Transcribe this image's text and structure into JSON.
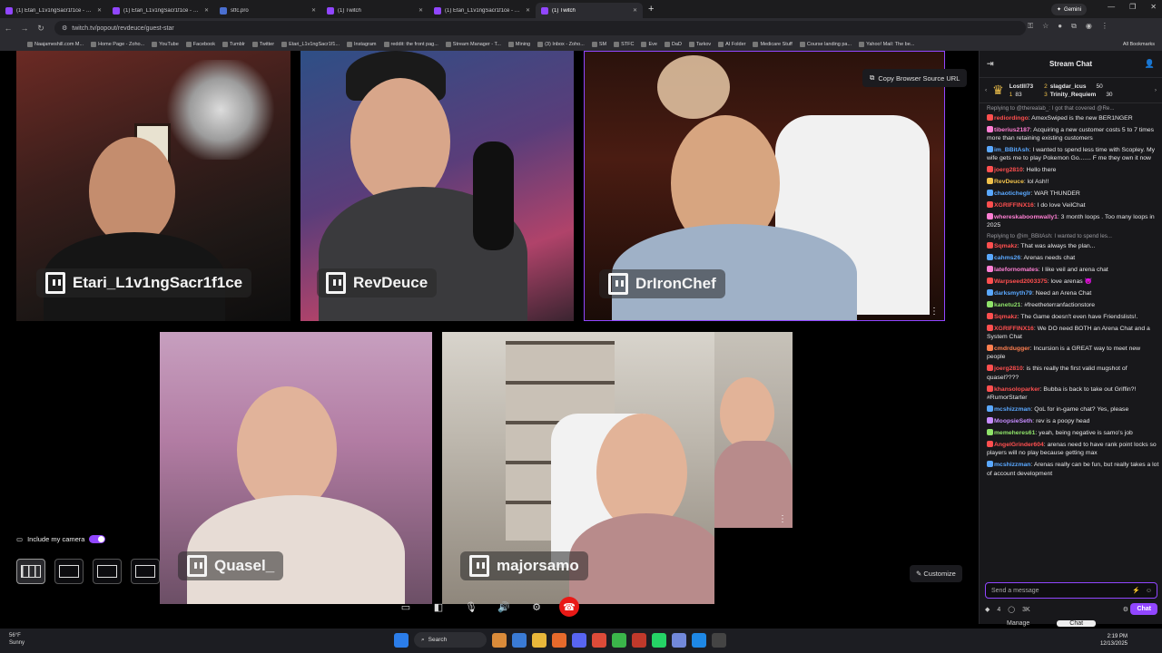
{
  "tabs": [
    {
      "title": "(1) Etari_L1v1ngSacr1f1ce - Vid",
      "active": false
    },
    {
      "title": "(1) Etari_L1v1ngSacr1f1ce - Vid",
      "active": false
    },
    {
      "title": "stfc.pro",
      "active": false
    },
    {
      "title": "(1) Twitch",
      "active": false
    },
    {
      "title": "(1) Etari_L1v1ngSacr1f1ce - Twi",
      "active": false
    },
    {
      "title": "(1) Twitch",
      "active": true
    }
  ],
  "gemini": "Gemini",
  "url": "twitch.tv/popout/revdeuce/guest-star",
  "bookmarks": [
    "Naajameshill.com M...",
    "Home Page - Zoho...",
    "YouTube",
    "Facebook",
    "Tumblr",
    "Twitter",
    "Etari_L1v1ngSacr1f1...",
    "Instagram",
    "reddit: the front pag...",
    "Stream Manager - T...",
    "Mining",
    "(3) Inbox - Zoho...",
    "SM",
    "STFC",
    "Eve",
    "DaD",
    "Tarkov",
    "AI Folder",
    "Medicare Stuff",
    "Course landing pa...",
    "Yahoo! Mail: The be..."
  ],
  "all_bookmarks": "All Bookmarks",
  "stage": {
    "copy_url": "Copy Browser Source URL",
    "include_camera": "Include my camera",
    "customize": "Customize",
    "participants": [
      {
        "name": "Etari_L1v1ngSacr1f1ce"
      },
      {
        "name": "RevDeuce"
      },
      {
        "name": "DrIronChef"
      },
      {
        "name": "Quasel_"
      },
      {
        "name": "majorsamo"
      }
    ]
  },
  "chat": {
    "title": "Stream Chat",
    "leaderboard": [
      {
        "name": "Lostlll73",
        "value": "83",
        "medal": "1"
      },
      {
        "name": "slagdar_icus",
        "value": "50",
        "medal": "2"
      },
      {
        "name": "Trinity_Requiem",
        "value": "30",
        "medal": "3"
      }
    ],
    "messages": [
      {
        "reply": "Replying to @therealab_: I got that covered @Re...",
        "user": "rediordingo",
        "color": "#ff4f4f",
        "text": "AmexSwiped is the new BER1NGER"
      },
      {
        "user": "tiberius2187",
        "color": "#ff7fd4",
        "text": "Acquiring a new customer costs 5 to 7 times more than retaining existing customers"
      },
      {
        "user": "im_BBitAsh",
        "color": "#5aa8ff",
        "text": "I wanted to spend less time with Scopley. My wife gets me to play Pokemon Go....... F me they own it now"
      },
      {
        "user": "joerg2810",
        "color": "#ff4f4f",
        "text": "Hello there"
      },
      {
        "user": "RevDeuce",
        "color": "#f0c14b",
        "text": "lol Ash!!"
      },
      {
        "user": "chaoticheglr",
        "color": "#5aa8ff",
        "text": "WAR THUNDER"
      },
      {
        "user": "XGRIFFINX16",
        "color": "#ff4f4f",
        "text": "I do love VeilChat"
      },
      {
        "user": "whereskaboomwally1",
        "color": "#ff7fd4",
        "text": "3 month loops . Too many loops in 2025"
      },
      {
        "reply": "Replying to @im_BBitAsh: I wanted to spend les...",
        "user": "Sqmakz",
        "color": "#ff4f4f",
        "text": "That was always the plan..."
      },
      {
        "user": "cahms26",
        "color": "#5aa8ff",
        "text": "Arenas needs chat"
      },
      {
        "user": "latefornomates",
        "color": "#ff7fd4",
        "text": "I like veil and arena chat"
      },
      {
        "user": "Warpseed2003375",
        "color": "#ff4f4f",
        "text": "love arenas 😈"
      },
      {
        "user": "darksmyth79",
        "color": "#5aa8ff",
        "text": "Need an Arena Chat"
      },
      {
        "user": "kanetu21",
        "color": "#8fe36a",
        "text": "#freetheterranfactionstore"
      },
      {
        "user": "Sqmakz",
        "color": "#ff4f4f",
        "text": "The Game doesn't even have Friendslists!."
      },
      {
        "user": "XGRIFFINX16",
        "color": "#ff4f4f",
        "text": "We DO need BOTH an Arena Chat and a System Chat"
      },
      {
        "user": "cmdrdugger",
        "color": "#ff7f50",
        "text": "Incursion is a GREAT way to meet new people"
      },
      {
        "user": "joerg2810",
        "color": "#ff4f4f",
        "text": "is this really the first valid mugshot of quasel????"
      },
      {
        "user": "khansoloparker",
        "color": "#ff4f4f",
        "text": "Bubba is back to take out Griffin?! #RumorStarter"
      },
      {
        "user": "mcshizzman",
        "color": "#5aa8ff",
        "text": "QoL for in-game chat? Yes, please"
      },
      {
        "user": "MoopsieSeth",
        "color": "#c68cff",
        "text": "rev is a poopy head"
      },
      {
        "user": "memeheres61",
        "color": "#8fe36a",
        "text": "yeah, being negative is samo's job"
      },
      {
        "user": "AngelGrinder604",
        "color": "#ff4f4f",
        "text": "arenas need to have rank point locks so players will no play because getting max"
      },
      {
        "user": "mcshizzman",
        "color": "#5aa8ff",
        "text": "Arenas really can be fun, but really takes a lot of account development"
      }
    ],
    "input_placeholder": "Send a message",
    "points_a": "4",
    "points_b": "3K",
    "chat_button": "Chat",
    "manage": "Manage",
    "chat_tab": "Chat"
  },
  "taskbar": {
    "temp": "56°F",
    "weather": "Sunny",
    "search": "Search",
    "time": "2:19 PM",
    "date": "12/13/2025"
  }
}
